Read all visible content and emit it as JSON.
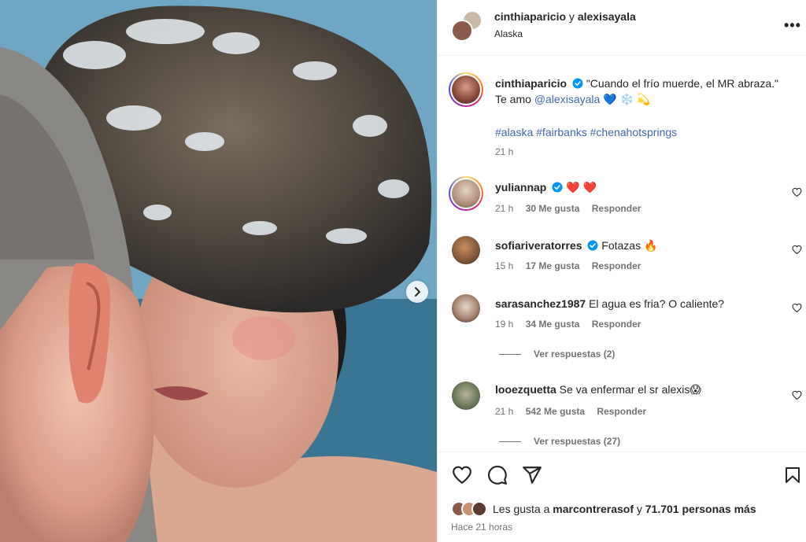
{
  "post": {
    "header": {
      "author": "cinthiaparicio",
      "connector": "y",
      "coauthor": "alexisayala",
      "location": "Alaska",
      "more_glyph": "•••"
    },
    "caption": {
      "username": "cinthiaparicio",
      "text_quote": "\"Cuando el frío muerde, el MR abraza.\"",
      "text_te_amo": "Te amo",
      "mention": "@alexisayala",
      "emojis": "💙 ❄️ 💫",
      "hashtags": "#alaska #fairbanks #chenahotsprings",
      "time": "21 h"
    },
    "comments": [
      {
        "username": "yuliannap",
        "verified": true,
        "text": "❤️ ❤️",
        "time": "21 h",
        "likes": "30 Me gusta",
        "reply": "Responder"
      },
      {
        "username": "sofiariveratorres",
        "verified": true,
        "text": "Fotazas 🔥",
        "time": "15 h",
        "likes": "17 Me gusta",
        "reply": "Responder"
      },
      {
        "username": "sarasanchez1987",
        "verified": false,
        "text": "El agua es fria? O caliente?",
        "time": "19 h",
        "likes": "34 Me gusta",
        "reply": "Responder",
        "replies": "Ver respuestas (2)"
      },
      {
        "username": "looezquetta",
        "verified": false,
        "text": "Se va enfermar el sr alexis😱",
        "time": "21 h",
        "likes": "542 Me gusta",
        "reply": "Responder",
        "replies": "Ver respuestas (27)"
      }
    ],
    "likes": {
      "prefix": "Les gusta a",
      "user": "marcontrerasof",
      "connector": "y",
      "others": "71.701 personas más"
    },
    "posted": "Hace 21 horas",
    "icons": {
      "like": "heart-icon",
      "comment": "comment-icon",
      "share": "share-icon",
      "save": "bookmark-icon",
      "next": "chevron-right-icon",
      "verified": "verified-badge-icon"
    },
    "colors": {
      "link": "#4267b2",
      "verified": "#0095f6",
      "muted": "#737373",
      "text": "#262626"
    }
  }
}
